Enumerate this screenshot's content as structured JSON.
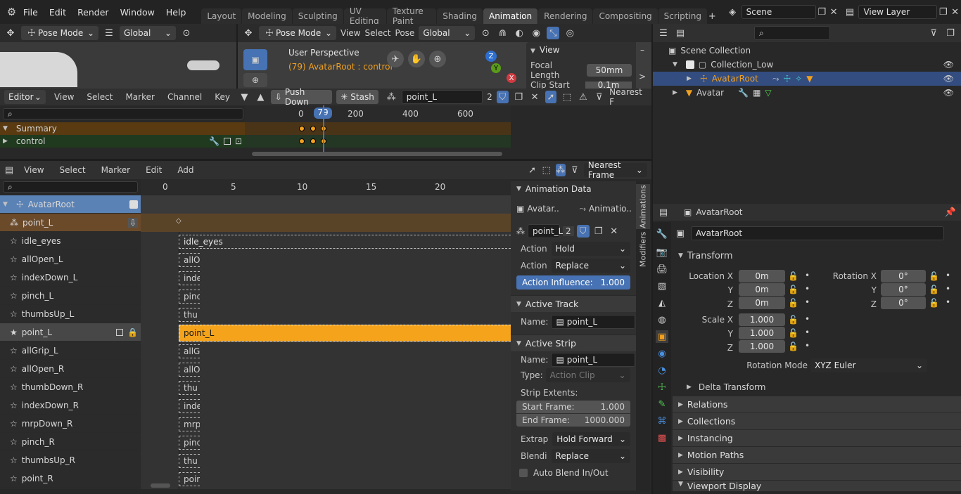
{
  "menu": [
    "File",
    "Edit",
    "Render",
    "Window",
    "Help"
  ],
  "workspaces": [
    "Layout",
    "Modeling",
    "Sculpting",
    "UV Editing",
    "Texture Paint",
    "Shading",
    "Animation",
    "Rendering",
    "Compositing",
    "Scripting"
  ],
  "active_workspace": "Animation",
  "scene": "Scene",
  "view_layer": "View Layer",
  "left_viewport": {
    "mode": "Pose Mode",
    "orientation": "Global"
  },
  "main_viewport": {
    "mode": "Pose Mode",
    "menus": [
      "View",
      "Select",
      "Pose"
    ],
    "orientation": "Global",
    "title": "User Perspective",
    "subtitle": "(79) AvatarRoot : control"
  },
  "view_panel": {
    "title": "View",
    "focal_label": "Focal Length",
    "focal_value": "50mm",
    "clip_label": "Clip Start",
    "clip_value": "0.1m"
  },
  "action_editor": {
    "editor": "Editor",
    "menus": [
      "View",
      "Select",
      "Marker",
      "Channel",
      "Key"
    ],
    "push_down": "Push Down",
    "stash": "Stash",
    "action": "point_L",
    "users": "2",
    "snap": "Nearest F",
    "ruler": [
      "0",
      "200",
      "400",
      "600"
    ],
    "current_frame": "79",
    "channels": [
      "Summary",
      "control"
    ]
  },
  "outliner": {
    "root": "Scene Collection",
    "items": [
      "Collection_Low",
      "AvatarRoot",
      "Avatar"
    ]
  },
  "nla": {
    "menus": [
      "View",
      "Select",
      "Marker",
      "Edit",
      "Add"
    ],
    "snap": "Nearest Frame",
    "ruler": [
      "0",
      "5",
      "10",
      "15",
      "20"
    ],
    "tracks": [
      "AvatarRoot",
      "point_L",
      "idle_eyes",
      "allOpen_L",
      "indexDown_L",
      "pinch_L",
      "thumbsUp_L",
      "point_L",
      "allGrip_L",
      "allOpen_R",
      "thumbDown_R",
      "indexDown_R",
      "mrpDown_R",
      "pinch_R",
      "thumbsUp_R",
      "point_R"
    ],
    "strips": [
      "idle_eyes",
      "allO",
      "inde",
      "pinc",
      "thu",
      "point_L",
      "allG",
      "allO",
      "thu",
      "inde",
      "mrp",
      "pinc",
      "thu",
      "poin"
    ]
  },
  "sidebar": {
    "tabs": [
      "Animations",
      "Modifiers"
    ],
    "anim_data": "Animation Data",
    "avatar_short": "Avatar..",
    "animation_short": "Animatio..",
    "action": "point_L",
    "users": "2",
    "action_hold_label": "Action",
    "action_hold": "Hold",
    "action_blend_label": "Action",
    "action_blend": "Replace",
    "influence_label": "Action Influence:",
    "influence": "1.000",
    "active_track": "Active Track",
    "name_label": "Name:",
    "track_name": "point_L",
    "active_strip": "Active Strip",
    "strip_name": "point_L",
    "type_label": "Type:",
    "type": "Action Clip",
    "extents": "Strip Extents:",
    "start_label": "Start Frame:",
    "start": "1.000",
    "end_label": "End Frame:",
    "end": "1000.000",
    "extrap_label": "Extrap",
    "extrap": "Hold Forward",
    "blend_label": "Blendi",
    "blend": "Replace",
    "auto_blend": "Auto Blend In/Out"
  },
  "properties": {
    "object": "AvatarRoot",
    "object_name": "AvatarRoot",
    "transform": "Transform",
    "loc_label": "Location X",
    "rot_label": "Rotation X",
    "scale_label": "Scale X",
    "y": "Y",
    "z": "Z",
    "loc": [
      "0m",
      "0m",
      "0m"
    ],
    "rot": [
      "0°",
      "0°",
      "0°"
    ],
    "scale": [
      "1.000",
      "1.000",
      "1.000"
    ],
    "rotation_mode_label": "Rotation Mode",
    "rotation_mode": "XYZ Euler",
    "sections": [
      "Delta Transform",
      "Relations",
      "Collections",
      "Instancing",
      "Motion Paths",
      "Visibility",
      "Viewport Display"
    ]
  },
  "colors": {
    "accent": "#f0a020",
    "selected": "#4772b3",
    "summary": "#5a3a10",
    "control": "#1f3a1f"
  }
}
